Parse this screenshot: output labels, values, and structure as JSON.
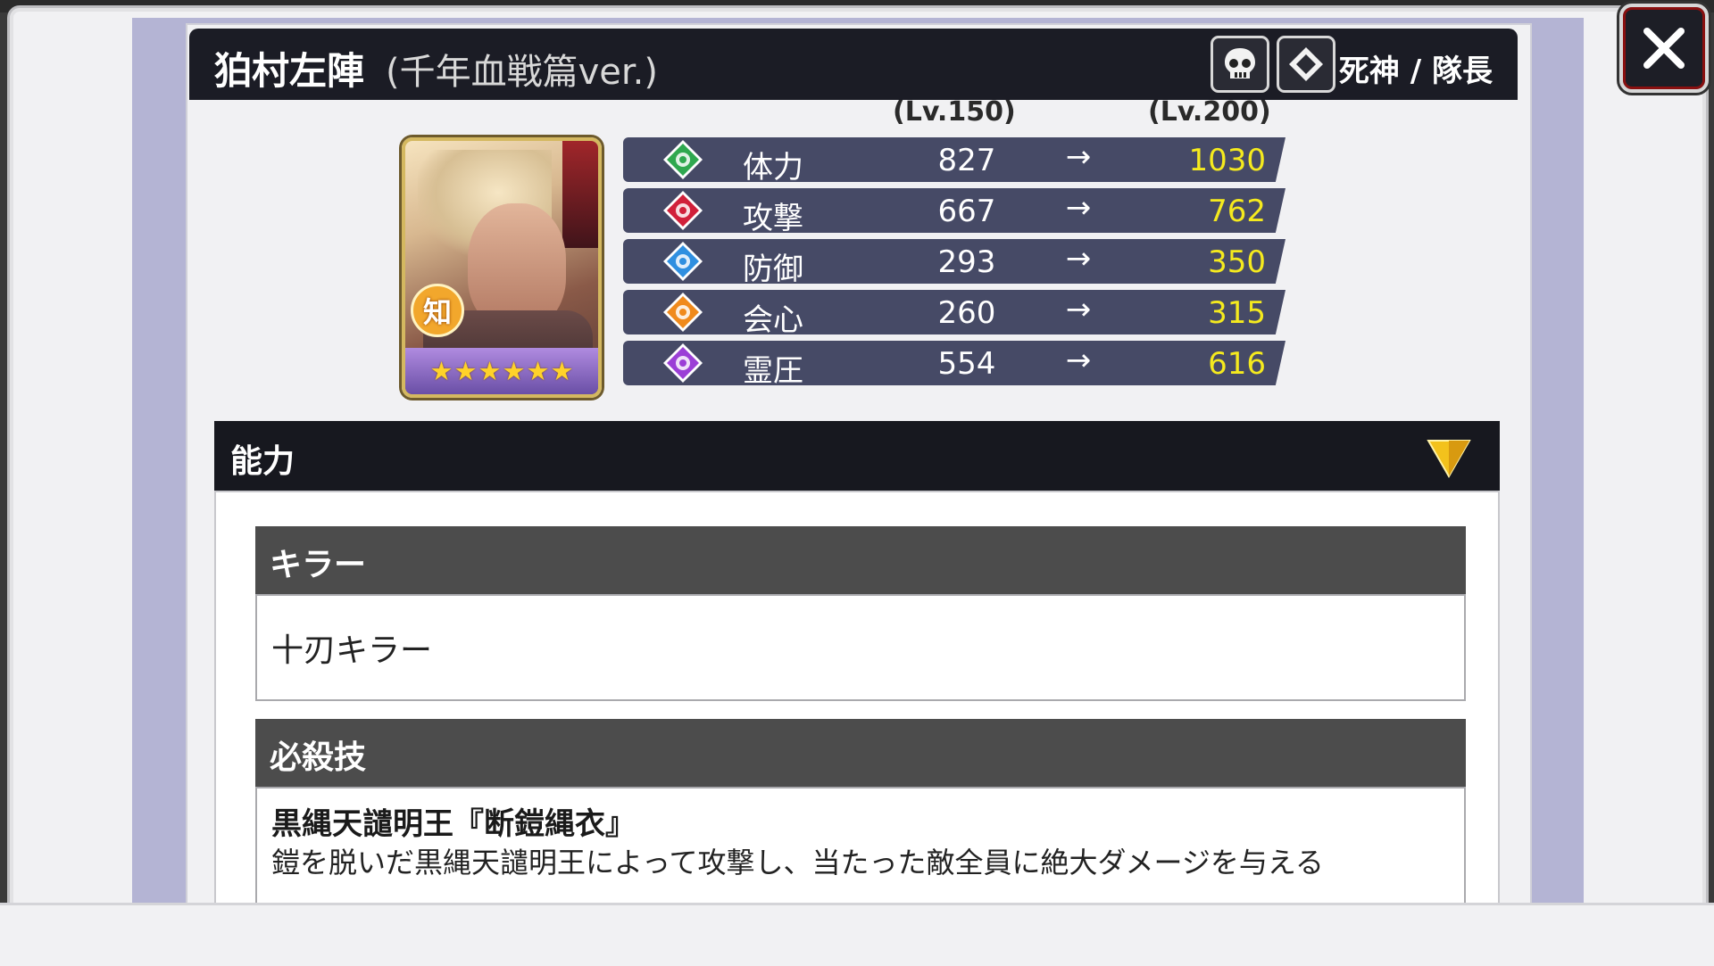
{
  "header": {
    "name": "狛村左陣",
    "variant": "(千年血戦篇ver.)",
    "type_label": "死神 / 隊長"
  },
  "levels": {
    "base": "(Lv.150)",
    "max": "(Lv.200)"
  },
  "unit": {
    "attribute_badge": "知",
    "rarity_stars": 6
  },
  "stats": [
    {
      "name": "体力",
      "base": "827",
      "arrow": "→",
      "max": "1030",
      "icon": "stamina-icon",
      "color": "#2fa84f"
    },
    {
      "name": "攻撃",
      "base": "667",
      "arrow": "→",
      "max": "762",
      "icon": "attack-icon",
      "color": "#d1203a"
    },
    {
      "name": "防御",
      "base": "293",
      "arrow": "→",
      "max": "350",
      "icon": "defense-icon",
      "color": "#2f8fe0"
    },
    {
      "name": "会心",
      "base": "260",
      "arrow": "→",
      "max": "315",
      "icon": "critical-icon",
      "color": "#f08a1c"
    },
    {
      "name": "霊圧",
      "base": "554",
      "arrow": "→",
      "max": "616",
      "icon": "reiatsu-icon",
      "color": "#9b3fd6"
    }
  ],
  "abilities": {
    "title": "能力",
    "killer": {
      "label": "キラー",
      "value": "十刃キラー"
    },
    "special": {
      "label": "必殺技",
      "name": "黒縄天譴明王『断鎧縄衣』",
      "description": "鎧を脱いだ黒縄天譴明王によって攻撃し、当たった敵全員に絶大ダメージを与える"
    }
  },
  "colors": {
    "max_value": "#f5ea1e",
    "title_bar": "#1b1c25",
    "stat_row": "#464a66"
  }
}
